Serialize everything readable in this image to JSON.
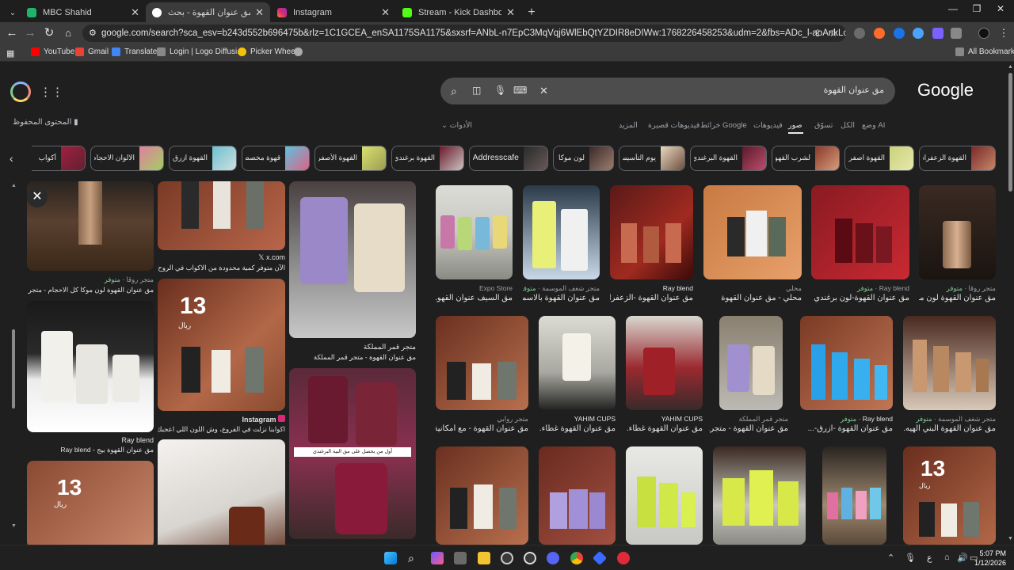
{
  "tabs": [
    {
      "label": "MBC Shahid",
      "color": "#1fb36b"
    },
    {
      "label": "مق عنوان القهوة - بحث Google",
      "color": "#4285f4"
    },
    {
      "label": "Instagram",
      "color": "#d62976"
    },
    {
      "label": "Stream - Kick Dashboard",
      "color": "#53fc18"
    }
  ],
  "toolbar": {
    "url": "google.com/search?sca_esv=b243d552b696475b&rlz=1C1GCEA_enSA1175SA1175&sxsrf=ANbL-n7EpC3MqVqj6WlEbQtYZDIR8eDIWw:1768226458253&udm=2&fbs=ADc_l-aoAnkLcbTr92phrBPsEtBzdc4k6pvHyiHE7..."
  },
  "bookmarks": [
    {
      "label": "YouTube",
      "color": "#ff0000"
    },
    {
      "label": "Gmail",
      "color": "#ea4335"
    },
    {
      "label": "Translate",
      "color": "#4285f4"
    },
    {
      "label": "Login | Logo Diffusi...",
      "color": "#888888"
    },
    {
      "label": "Picker Wheel",
      "color": "#f4c20d"
    },
    {
      "label": "",
      "color": "#aaaaaa"
    }
  ],
  "all_bookmarks": "All Bookmarks",
  "search": {
    "query": "مق عنوان القهوة",
    "logo": "Google",
    "saved": "المحتوى المحفوظ",
    "tools": "الأدوات"
  },
  "filters": [
    "وضع AI",
    "الكل",
    "تسوّق",
    "صور",
    "فيديوهات",
    "خرائط Google",
    "فيديوهات قصيرة",
    "المزيد"
  ],
  "chips": [
    "القهوة الزعفراني",
    "القهوة اصفر",
    "لشرب القهوة",
    "القهوة البرغندي",
    "يوم التأسيس",
    "لون موكا",
    "Addresscafe",
    "القهوة برغندي",
    "القهوة الأصفر",
    "قهوة مخصصة",
    "القهوة ازرق",
    "الالوان الاحجام",
    "أكواب"
  ],
  "grid": {
    "row1": [
      {
        "src": "متجر روقا",
        "title": "مق عنوان القهوة لون موكا ..."
      },
      {
        "src": "Ray blend",
        "title": "مق عنوان القهوة-لون برغندي ..."
      },
      {
        "src": "محلي",
        "title": "محلي - مق عنوان القهوة"
      },
      {
        "src": "Ray blend",
        "title": "مق عنوان القهوة -الزعفرا..."
      },
      {
        "src": "متجر شغف الموسمة",
        "title": "مق عنوان القهوة بالاسم..."
      },
      {
        "src": "Expo Store",
        "title": "مق السيف عنوان القهو..."
      }
    ],
    "row2": [
      {
        "src": "متجر شغف الموسمة",
        "title": "مق عنوان القهوة البني الهيه..."
      },
      {
        "src": "Ray blend",
        "title": "مق عنوان القهوة -ازرق-..."
      },
      {
        "src": "متجر قمر المملكة",
        "title": "مق عنوان القهوة - متجر..."
      },
      {
        "src": "YAHIM CUPS",
        "title": "مق عنوان القهوة غطاء..."
      },
      {
        "src": "YAHIM CUPS",
        "title": "مق عنوان القهوة غطاء..."
      },
      {
        "src": "متجر روابي",
        "title": "مق عنوان القهوة - مع امكانية..."
      }
    ],
    "available": "متوفر"
  },
  "preview": {
    "col1": [
      {
        "src": "متجر روقا",
        "title": "مق عنوان القهوة لون موكا كل الاحجام - متجر روقا"
      },
      {
        "src": "Ray blend",
        "title": "مق عنوان القهوة بيج - Ray blend"
      }
    ],
    "col2": [
      {
        "src": "x.com",
        "title": "الآن متوفر كمية محدودة من الاكواب في الروح الرياضي ..."
      },
      {
        "src": "Instagram",
        "title": "اكوابنا نزلت في الفروع، وش اللون اللي اعجبك؟ 😍 ..."
      }
    ],
    "col3": [
      {
        "src": "متجر قمر المملكة",
        "title": "مق عنوان القهوة - متجر قمر المملكة"
      }
    ],
    "price": "13",
    "currency": "ريال",
    "overlay": "أول من يحصل على مق البية البرغندي"
  },
  "taskbar": {
    "time": "5:07 PM",
    "date": "1/12/2026",
    "lang": "ع"
  }
}
